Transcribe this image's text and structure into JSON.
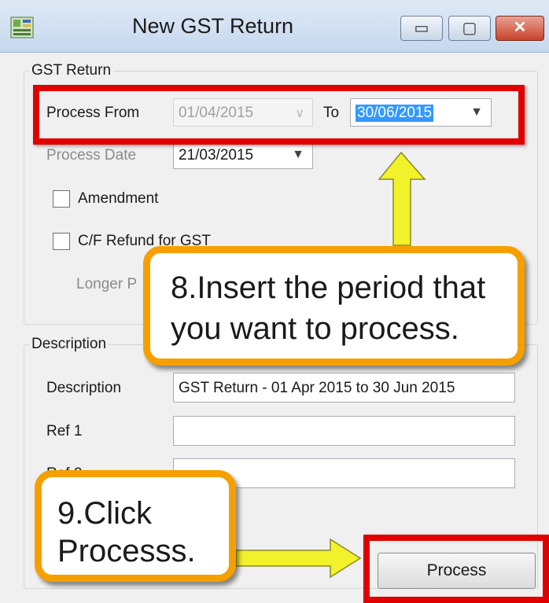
{
  "window": {
    "title": "New GST Return",
    "controls": {
      "minimize": "▭",
      "maximize": "▢",
      "close": "✕"
    }
  },
  "gst_return": {
    "legend": "GST Return",
    "process_from_label": "Process From",
    "process_from_value": "01/04/2015",
    "to_label": "To",
    "to_value": "30/06/2015",
    "process_date_label": "Process Date",
    "process_date_value": "21/03/2015",
    "amendment_label": "Amendment",
    "cf_refund_label": "C/F Refund for GST",
    "longer_label": "Longer P"
  },
  "description": {
    "legend": "Description",
    "description_label": "Description",
    "description_value": "GST Return - 01 Apr 2015 to 30 Jun 2015",
    "ref1_label": "Ref 1",
    "ref1_value": "",
    "ref2_label": "Ref 2",
    "ref2_value": ""
  },
  "actions": {
    "process_label": "Process"
  },
  "annotations": {
    "callout_period": "8.Insert the period that you want to process.",
    "callout_process": "9.Click Processs.",
    "highlight_color": "#e00000",
    "callout_border_color": "#f5a000",
    "arrow_color": "#f2f22a"
  }
}
